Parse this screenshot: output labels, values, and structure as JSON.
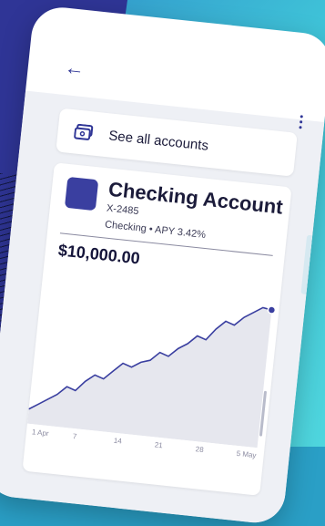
{
  "header": {
    "back_icon": "arrow-left-icon",
    "menu_icon": "more-vertical-icon"
  },
  "accounts_link": {
    "icon": "wallet-icon",
    "label": "See all accounts"
  },
  "account": {
    "title": "Checking Account",
    "number": "X-2485",
    "meta": "Checking • APY 3.42%",
    "balance": "$10,000.00"
  },
  "chart_data": {
    "type": "area",
    "x": [
      "1 Apr",
      "7",
      "14",
      "21",
      "28",
      "5 May"
    ],
    "series": [
      {
        "values": [
          10,
          14,
          18,
          22,
          28,
          26,
          33,
          38,
          36,
          42,
          48,
          46,
          50,
          52,
          58,
          56,
          62,
          66,
          72,
          70,
          78,
          84,
          82,
          88,
          92,
          96,
          95
        ]
      }
    ],
    "ylim": [
      0,
      100
    ]
  },
  "colors": {
    "accent": "#3a3fa0",
    "line": "#3a3fa0",
    "area": "#e6e7ee"
  }
}
